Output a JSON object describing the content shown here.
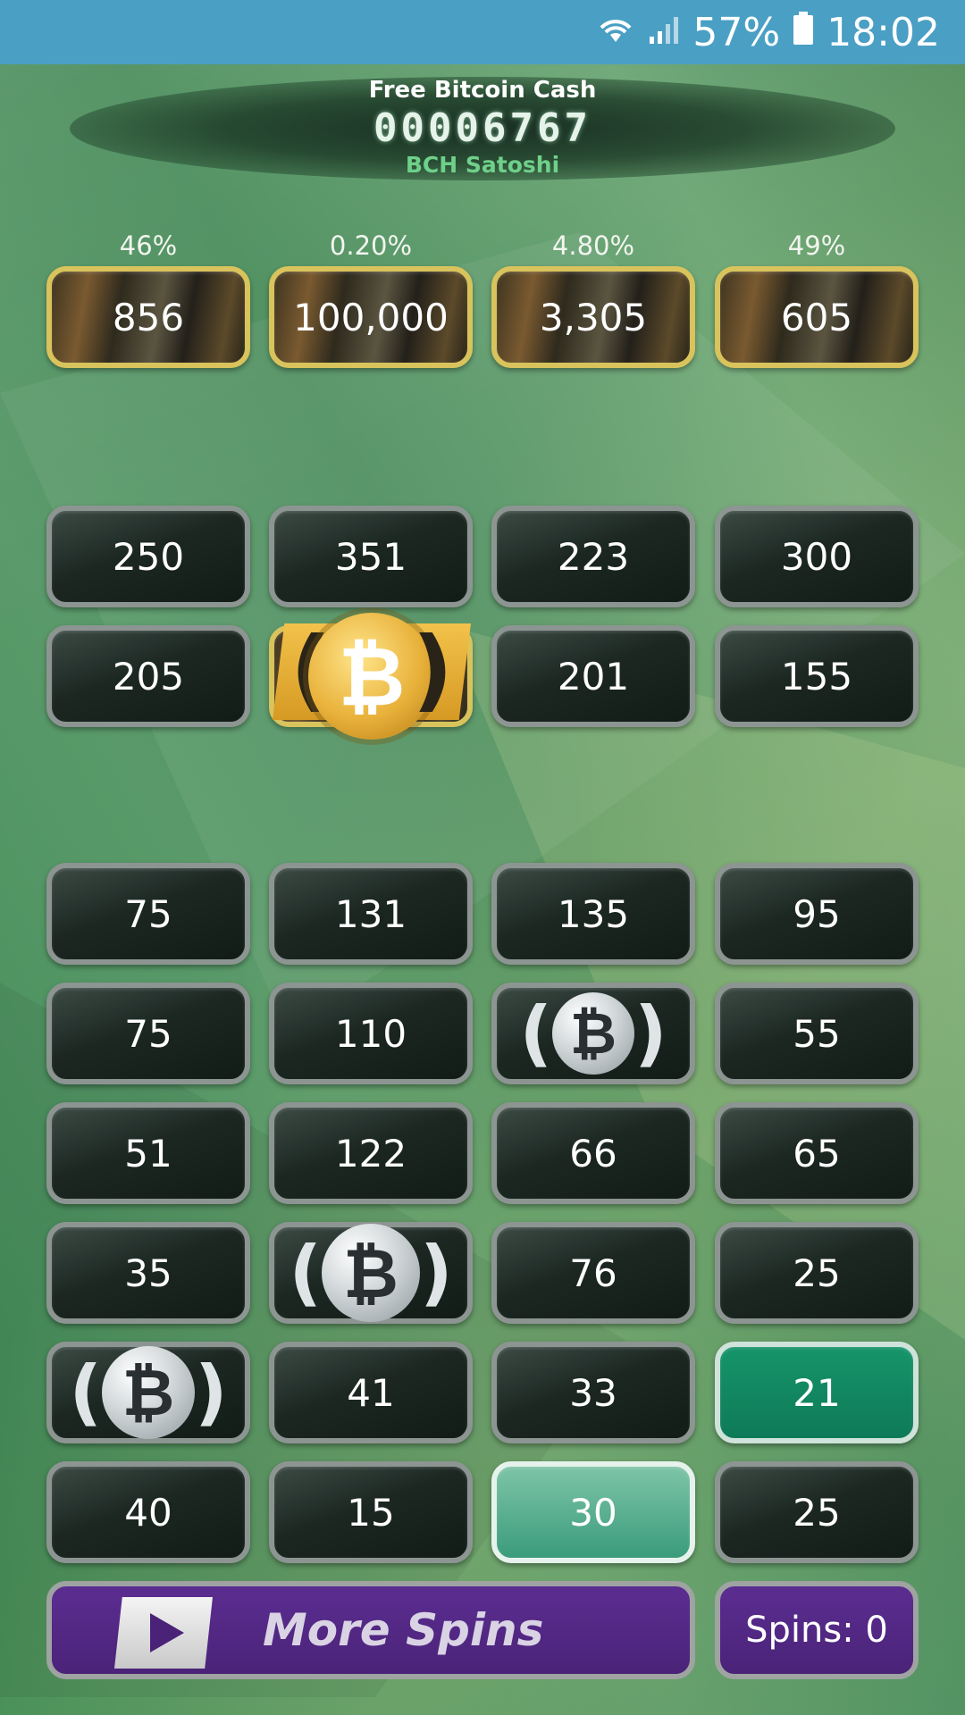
{
  "status_bar": {
    "battery": "57%",
    "time": "18:02"
  },
  "header": {
    "title": "Free Bitcoin Cash",
    "amount": "00006767",
    "unit": "BCH Satoshi"
  },
  "prize_row": {
    "percents": [
      "46%",
      "0.20%",
      "4.80%",
      "49%"
    ],
    "values": [
      "856",
      "100,000",
      "3,305",
      "605"
    ]
  },
  "grid_top": [
    [
      "250",
      "351",
      "223",
      "300"
    ],
    [
      "205",
      "",
      "201",
      "155"
    ]
  ],
  "grid_bottom": [
    [
      "75",
      "131",
      "135",
      "95"
    ],
    [
      "75",
      "110",
      "",
      "55"
    ],
    [
      "51",
      "122",
      "66",
      "65"
    ],
    [
      "35",
      "",
      "76",
      "25"
    ],
    [
      "",
      "41",
      "33",
      "21"
    ],
    [
      "40",
      "15",
      "30",
      "25"
    ]
  ],
  "icons": {
    "coin": "₿"
  },
  "actions": {
    "more_spins": "More Spins",
    "spins_count": "Spins: 0"
  },
  "colors": {
    "status_bar": "#4a9fc4",
    "tile_border_gold": "#d8c35c",
    "button_purple": "#5b2d91",
    "teal_dark": "#16946a",
    "teal_light": "#7ec4a8"
  }
}
